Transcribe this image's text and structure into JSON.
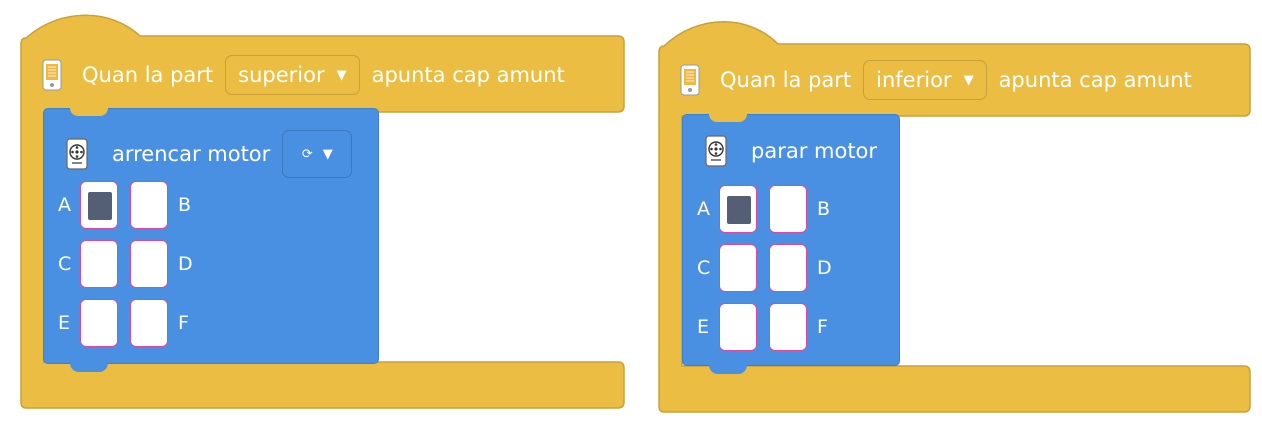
{
  "colors": {
    "event_block": "#ebbd42",
    "event_block_border": "#c9a03a",
    "command_block": "#4a90e2",
    "checkbox_checked": "#545e75"
  },
  "blocks": [
    {
      "event": {
        "prefix": "Quan la part",
        "dropdown_value": "superior",
        "suffix": "apunta cap amunt",
        "icon": "controller-icon"
      },
      "command": {
        "label": "arrencar motor",
        "icon": "motor-icon",
        "direction_symbol": "⟳",
        "ports": [
          {
            "label": "A",
            "checked": true
          },
          {
            "label": "B",
            "checked": false
          },
          {
            "label": "C",
            "checked": false
          },
          {
            "label": "D",
            "checked": false
          },
          {
            "label": "E",
            "checked": false
          },
          {
            "label": "F",
            "checked": false
          }
        ]
      }
    },
    {
      "event": {
        "prefix": "Quan la part",
        "dropdown_value": "inferior",
        "suffix": "apunta cap amunt",
        "icon": "controller-icon"
      },
      "command": {
        "label": "parar motor",
        "icon": "motor-icon",
        "ports": [
          {
            "label": "A",
            "checked": true
          },
          {
            "label": "B",
            "checked": false
          },
          {
            "label": "C",
            "checked": false
          },
          {
            "label": "D",
            "checked": false
          },
          {
            "label": "E",
            "checked": false
          },
          {
            "label": "F",
            "checked": false
          }
        ]
      }
    }
  ]
}
